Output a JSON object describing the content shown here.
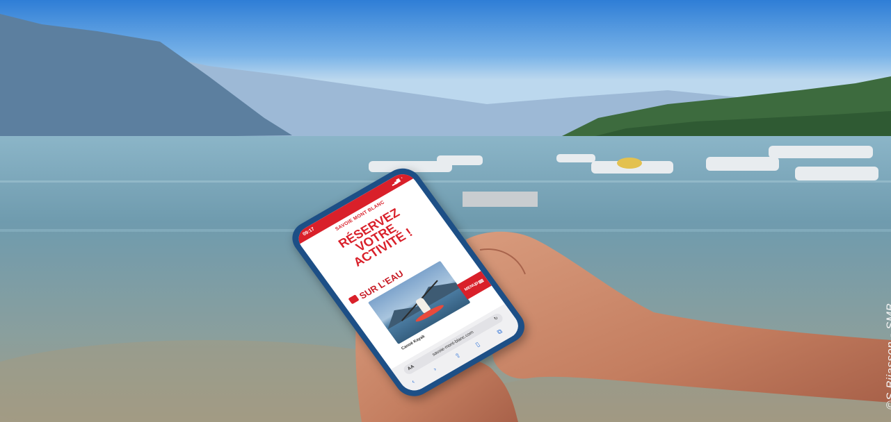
{
  "photo_credit": "©S Bijasson - SMB",
  "phone": {
    "status_time": "09:17",
    "status_icons": "▂▄▆ ◔",
    "brand": "SAVOIE MONT BLANC",
    "headline_lines": [
      "RÉSERVEZ",
      "VOTRE",
      "ACTIVITÉ !"
    ],
    "section_title": "SUR L'EAU",
    "card_caption": "Canoë Kayak",
    "menu_label": "MENU",
    "menu_icon": "search-menu-icon",
    "url": "savoie-mont-blanc.com",
    "url_prefix": "AA",
    "nav_icons": [
      "back-icon",
      "forward-icon",
      "share-icon",
      "bookmarks-icon",
      "tabs-icon"
    ]
  },
  "colors": {
    "brand_red": "#d9202a",
    "sky_top": "#3f86d6",
    "lake": "#7fa6b8",
    "phone_case": "#1d4f86"
  }
}
